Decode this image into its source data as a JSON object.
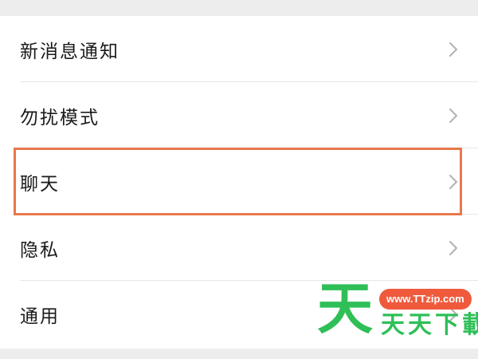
{
  "settings": {
    "items": [
      {
        "label": "新消息通知",
        "icon": "chevron-right-icon"
      },
      {
        "label": "勿扰模式",
        "icon": "chevron-right-icon"
      },
      {
        "label": "聊天",
        "icon": "chevron-right-icon",
        "highlighted": true
      },
      {
        "label": "隐私",
        "icon": "chevron-right-icon"
      },
      {
        "label": "通用",
        "icon": "chevron-right-icon"
      }
    ],
    "highlight_color": "#e8784a"
  },
  "watermark": {
    "big_char": "天",
    "url": "www.TTzip.com",
    "name": "天天下載",
    "green": "#2fbf57",
    "red": "#ef5a3d"
  }
}
